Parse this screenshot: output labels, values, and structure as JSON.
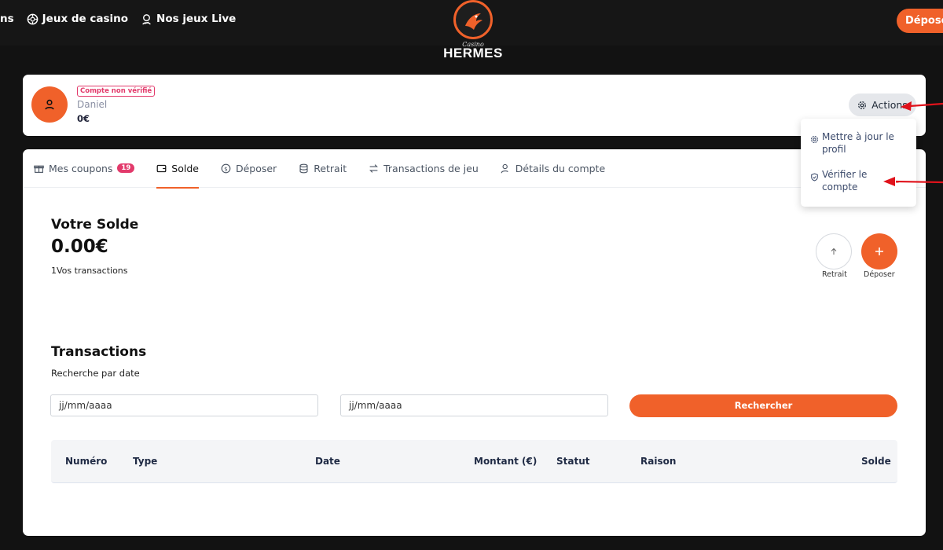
{
  "topnav": {
    "partial_label": "ns",
    "casino_games": "Jeux de casino",
    "live_games": "Nos jeux Live",
    "deposit_button": "Déposer"
  },
  "logo": {
    "script": "Casino",
    "word": "HERMES"
  },
  "profile": {
    "badge": "Compte non vérifié",
    "name": "Daniel",
    "balance": "0€",
    "actions_label": "Actions"
  },
  "actions_menu": {
    "items": [
      {
        "label_line1": "Mettre à jour le",
        "label_line2": "profil",
        "icon": "gear-icon"
      },
      {
        "label_line1": "Vérifier le",
        "label_line2": "compte",
        "icon": "shield-icon"
      }
    ]
  },
  "tabs": [
    {
      "label": "Mes coupons",
      "icon": "gift-icon",
      "count": "19"
    },
    {
      "label": "Solde",
      "icon": "wallet-icon",
      "active": true
    },
    {
      "label": "Déposer",
      "icon": "dollar-circle-icon"
    },
    {
      "label": "Retrait",
      "icon": "database-icon"
    },
    {
      "label": "Transactions de jeu",
      "icon": "swap-icon"
    },
    {
      "label": "Détails du compte",
      "icon": "user-icon"
    }
  ],
  "balance": {
    "title": "Votre Solde",
    "amount": "0.00€",
    "subtitle": "1Vos transactions",
    "withdraw_label": "Retrait",
    "deposit_label": "Déposer"
  },
  "transactions": {
    "title": "Transactions",
    "search_label": "Recherche par date",
    "date_from_placeholder": "jj/mm/aaaa",
    "date_to_placeholder": "jj/mm/aaaa",
    "search_button": "Rechercher",
    "columns": [
      "Numéro",
      "Type",
      "Date",
      "Montant (€)",
      "Statut",
      "Raison",
      "Solde"
    ]
  },
  "colors": {
    "accent": "#f0612a",
    "badge": "#e23a6b",
    "annotation_arrow": "#e0121b"
  }
}
